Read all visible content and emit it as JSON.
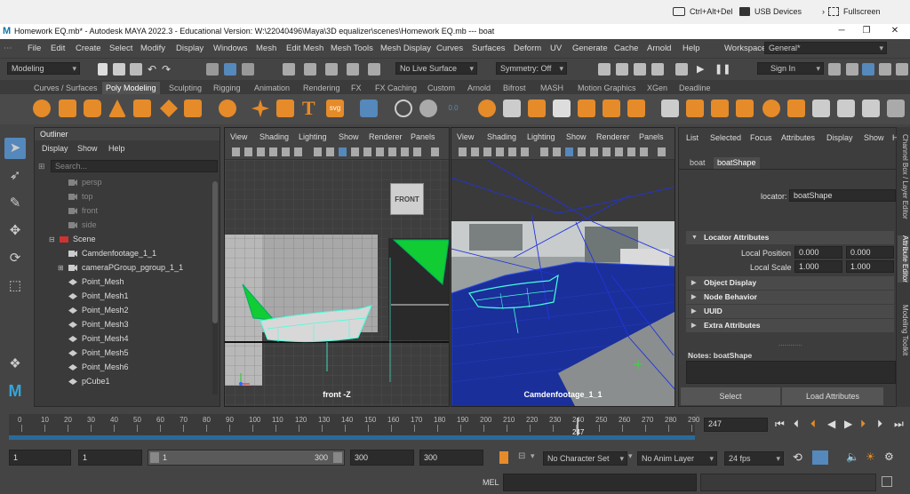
{
  "remote_bar": {
    "ctrl_alt_del": "Ctrl+Alt+Del",
    "usb_devices": "USB Devices",
    "fullscreen": "Fullscreen"
  },
  "title_bar": {
    "title": "Homework EQ.mb* - Autodesk MAYA 2022.3 - Educational Version: W:\\22040496\\Maya\\3D equalizer\\scenes\\Homework EQ.mb   ---   boat"
  },
  "menu": {
    "items": [
      "File",
      "Edit",
      "Create",
      "Select",
      "Modify",
      "Display",
      "Windows",
      "Mesh",
      "Edit Mesh",
      "Mesh Tools",
      "Mesh Display",
      "Curves",
      "Surfaces",
      "Deform",
      "UV",
      "Generate",
      "Cache",
      "Arnold",
      "Help"
    ],
    "workspace_label": "Workspace:",
    "workspace_value": "General*"
  },
  "status_line": {
    "mode": "Modeling",
    "live_surface": "No Live Surface",
    "symmetry": "Symmetry: Off",
    "sign_in": "Sign In"
  },
  "shelf": {
    "tabs": [
      "Curves / Surfaces",
      "Poly Modeling",
      "Sculpting",
      "Rigging",
      "Animation",
      "Rendering",
      "FX",
      "FX Caching",
      "Custom",
      "Arnold",
      "Bifrost",
      "MASH",
      "Motion Graphics",
      "XGen",
      "Deadline"
    ],
    "active_tab": "Poly Modeling",
    "svg_label": "svg"
  },
  "outliner": {
    "title": "Outliner",
    "menu": [
      "Display",
      "Show",
      "Help"
    ],
    "search_placeholder": "Search...",
    "items": [
      {
        "label": "persp",
        "type": "camera",
        "dim": true,
        "indent": 1
      },
      {
        "label": "top",
        "type": "camera",
        "dim": true,
        "indent": 1
      },
      {
        "label": "front",
        "type": "camera",
        "dim": true,
        "indent": 1
      },
      {
        "label": "side",
        "type": "camera",
        "dim": true,
        "indent": 1
      },
      {
        "label": "Scene",
        "type": "scene",
        "dim": false,
        "indent": 0
      },
      {
        "label": "Camdenfootage_1_1",
        "type": "camera",
        "dim": false,
        "indent": 1
      },
      {
        "label": "cameraPGroup_pgroup_1_1",
        "type": "group",
        "dim": false,
        "indent": 1
      },
      {
        "label": "Point_Mesh",
        "type": "mesh",
        "dim": false,
        "indent": 1
      },
      {
        "label": "Point_Mesh1",
        "type": "mesh",
        "dim": false,
        "indent": 1
      },
      {
        "label": "Point_Mesh2",
        "type": "mesh",
        "dim": false,
        "indent": 1
      },
      {
        "label": "Point_Mesh3",
        "type": "mesh",
        "dim": false,
        "indent": 1
      },
      {
        "label": "Point_Mesh4",
        "type": "mesh",
        "dim": false,
        "indent": 1
      },
      {
        "label": "Point_Mesh5",
        "type": "mesh",
        "dim": false,
        "indent": 1
      },
      {
        "label": "Point_Mesh6",
        "type": "mesh",
        "dim": false,
        "indent": 1
      },
      {
        "label": "pCube1",
        "type": "mesh",
        "dim": false,
        "indent": 1
      }
    ]
  },
  "viewport_left": {
    "menu": [
      "View",
      "Shading",
      "Lighting",
      "Show",
      "Renderer",
      "Panels"
    ],
    "view_cube": "FRONT",
    "camera_label": "front -Z"
  },
  "viewport_right": {
    "menu": [
      "View",
      "Shading",
      "Lighting",
      "Show",
      "Renderer",
      "Panels"
    ],
    "camera_label": "Camdenfootage_1_1"
  },
  "attribute_editor": {
    "menu": [
      "List",
      "Selected",
      "Focus",
      "Attributes",
      "Display",
      "Show",
      "H"
    ],
    "tabs": [
      "boat",
      "boatShape"
    ],
    "active_tab": "boatShape",
    "locator_label": "locator:",
    "locator_value": "boatShape",
    "sections": {
      "locator_attributes": "Locator Attributes",
      "object_display": "Object Display",
      "node_behavior": "Node Behavior",
      "uuid": "UUID",
      "extra_attributes": "Extra Attributes"
    },
    "local_position_label": "Local Position",
    "local_position": [
      "0.000",
      "0.000"
    ],
    "local_scale_label": "Local Scale",
    "local_scale": [
      "1.000",
      "1.000"
    ],
    "notes_label": "Notes:  boatShape",
    "select_button": "Select",
    "load_button": "Load Attributes"
  },
  "side_tabs": [
    "Channel Box / Layer Editor",
    "Attribute Editor",
    "Modeling Toolkit"
  ],
  "time_slider": {
    "tick_labels": [
      "0",
      "10",
      "20",
      "30",
      "40",
      "50",
      "60",
      "70",
      "80",
      "90",
      "100",
      "110",
      "120",
      "130",
      "140",
      "150",
      "160",
      "170",
      "180",
      "190",
      "200",
      "210",
      "220",
      "230",
      "240",
      "250",
      "260",
      "270",
      "280",
      "290"
    ],
    "current_frame": "247",
    "current_frame_field": "247"
  },
  "range_slider": {
    "start_field": "1",
    "start_field2": "1",
    "range_start": "1",
    "range_end": "300",
    "end_field": "300",
    "end_field2": "300",
    "character_set": "No Character Set",
    "anim_layer": "No Anim Layer",
    "fps": "24 fps"
  },
  "command_line": {
    "mel_label": "MEL"
  },
  "colors": {
    "accent_blue": "#5588bb",
    "shelf_orange": "#e58b2a",
    "selection_green": "#11cc33",
    "timeline_blue": "#2a6a9a"
  }
}
